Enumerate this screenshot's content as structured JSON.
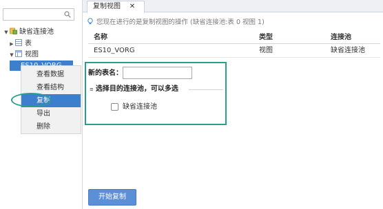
{
  "tree": {
    "root_label": "缺省连接池",
    "tables_label": "表",
    "views_label": "视图",
    "selected_label": "ES10_VORG"
  },
  "context_menu": {
    "items": [
      "查看数据",
      "查看结构",
      "复制",
      "导出",
      "删除"
    ],
    "active_index": 2
  },
  "tab": {
    "label": "复制视图",
    "close_glyph": "✕"
  },
  "info": {
    "text": "您现在进行的是复制视图的操作 (缺省连接池:表 0 视图 1)"
  },
  "table": {
    "headers": [
      "名称",
      "类型",
      "连接池"
    ],
    "rows": [
      [
        "ES10_VORG",
        "视图",
        "缺省连接池"
      ]
    ]
  },
  "form": {
    "new_name_label": "新的表名：",
    "new_name_value": "",
    "section_prefix": "≡",
    "section_title": "选择目的连接池，可以多选",
    "option_label": "缺省连接池",
    "option_checked": false
  },
  "actions": {
    "start_label": "开始复制"
  },
  "colors": {
    "accent": "#3d7fcc",
    "highlight": "#2a9d8f",
    "button": "#5b8fd6"
  },
  "icons": {
    "search": "search-icon",
    "database": "database-icon",
    "table": "table-icon",
    "view": "view-icon",
    "info": "lightbulb-icon",
    "close": "close-icon"
  }
}
